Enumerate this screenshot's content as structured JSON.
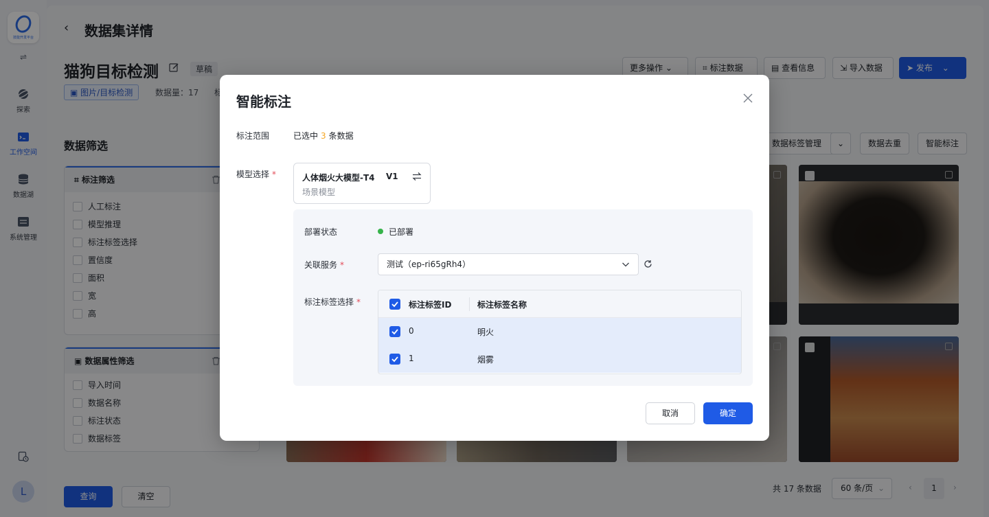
{
  "rail": {
    "logo_text": "技能开发平台",
    "items": [
      {
        "label": "探索"
      },
      {
        "label": "工作空间"
      },
      {
        "label": "数据湖"
      },
      {
        "label": "系统管理"
      }
    ],
    "avatar": "L"
  },
  "header": {
    "page_title": "数据集详情",
    "dataset_name": "猫狗目标检测",
    "status_tag": "草稿",
    "type_tag": "图片/目标检测",
    "count_label": "数据量：17",
    "extra_label": "标",
    "actions": {
      "more": "更多操作",
      "annotate": "标注数据",
      "info": "查看信息",
      "import": "导入数据",
      "publish": "发布"
    }
  },
  "filters": {
    "title": "数据筛选",
    "annotation_filter": {
      "title": "标注筛选",
      "items": [
        "人工标注",
        "模型推理",
        "标注标签选择",
        "置信度",
        "面积",
        "宽",
        "高"
      ]
    },
    "attr_filter": {
      "title": "数据属性筛选",
      "items": [
        "导入时间",
        "数据名称",
        "标注状态",
        "数据标签"
      ]
    },
    "query": "查询",
    "clear": "清空"
  },
  "grid_toolbar": {
    "tag_manage": "数据标签管理",
    "dedupe": "数据去重",
    "smart": "智能标注"
  },
  "pagination": {
    "total": "共 17 条数据",
    "page_size": "60 条/页",
    "current": "1"
  },
  "modal": {
    "title": "智能标注",
    "scope_label": "标注范围",
    "scope_prefix": "已选中",
    "scope_num": "3",
    "scope_suffix": "条数据",
    "model_label": "模型选择",
    "model_name": "人体烟火大模型-T4",
    "model_version": "V1",
    "model_type": "场景模型",
    "deploy_label": "部署状态",
    "deploy_status": "已部署",
    "service_label": "关联服务",
    "service_value": "测试（ep-ri65gRh4）",
    "tag_label": "标注标签选择",
    "table": {
      "headers": [
        "标注标签ID",
        "标注标签名称"
      ],
      "rows": [
        {
          "id": "0",
          "name": "明火"
        },
        {
          "id": "1",
          "name": "烟雾"
        }
      ]
    },
    "cancel": "取消",
    "confirm": "确定"
  },
  "colors": {
    "primary": "#1f5be6",
    "highlight_num": "#f5a623",
    "deployed": "#36b34a",
    "required": "#e34d59"
  }
}
